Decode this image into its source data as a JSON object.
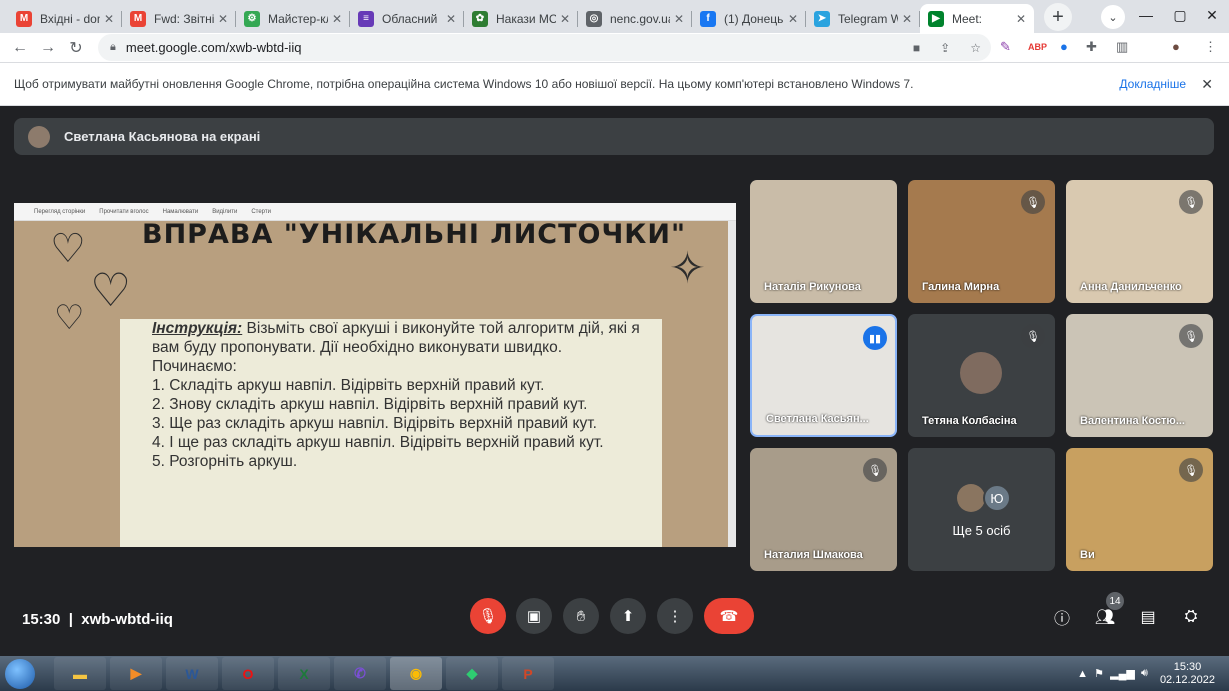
{
  "browser": {
    "tabs": [
      {
        "title": "Вхідні - dom",
        "icon": "gmail-icon",
        "color": "#ea4335",
        "glyph": "M"
      },
      {
        "title": "Fwd: Звітні",
        "icon": "gmail-icon",
        "color": "#ea4335",
        "glyph": "M"
      },
      {
        "title": "Майстер-кл",
        "icon": "site-icon",
        "color": "#34a853",
        "glyph": "⚙"
      },
      {
        "title": "Обласний",
        "icon": "forms-icon",
        "color": "#673ab7",
        "glyph": "≡"
      },
      {
        "title": "Накази МС",
        "icon": "site-icon",
        "color": "#2e7d32",
        "glyph": "✿"
      },
      {
        "title": "nenc.gov.ua",
        "icon": "globe-icon",
        "color": "#5f6368",
        "glyph": "◎"
      },
      {
        "title": "(1) Донець",
        "icon": "facebook-icon",
        "color": "#1877f2",
        "glyph": "f"
      },
      {
        "title": "Telegram W",
        "icon": "telegram-icon",
        "color": "#2aa3df",
        "glyph": "➤"
      },
      {
        "title": "Meet:",
        "icon": "meet-icon",
        "color": "#00832d",
        "glyph": "▶",
        "active": true
      }
    ],
    "url": "meet.google.com/xwb-wbtd-iiq",
    "infobar_text": "Щоб отримувати майбутні оновлення Google Chrome, потрібна операційна система Windows 10 або новішої версії. На цьому комп'ютері встановлено Windows 7.",
    "infobar_link": "Докладніше"
  },
  "meet": {
    "presenter_banner": "Светлана Касьянова на екрані",
    "slide": {
      "title": "ВПРАВА \"УНІКАЛЬНІ ЛИСТОЧКИ\"",
      "instruction_label": "Інструкція:",
      "instruction_intro": "Візьміть свої аркуші і виконуйте той алгоритм дій, які я вам буду пропонувати. Дії необхідно виконувати швидко. Починаємо:",
      "steps": [
        "1. Складіть аркуш навпіл. Відірвіть верхній правий кут.",
        "2. Знову складіть аркуш навпіл. Відірвіть верхній правий кут.",
        "3. Ще раз складіть аркуш навпіл. Відірвіть верхній правий кут.",
        "4. І ще раз складіть аркуш навпіл. Відірвіть верхній правий кут.",
        "5. Розгорніть аркуш."
      ],
      "viewer_tools": [
        "Перегляд сторінки",
        "Прочитати вголос",
        "Намалювати",
        "Виділити",
        "Стерти"
      ]
    },
    "participants": [
      {
        "name": "Наталія Рикунова",
        "muted": false,
        "bg": "#c9bca8"
      },
      {
        "name": "Галина Мирна",
        "muted": true,
        "bg": "#a57a4e"
      },
      {
        "name": "Анна Данильченко",
        "muted": true,
        "bg": "#d9c9b0"
      },
      {
        "name": "Светлана Касьян...",
        "muted": false,
        "speaking": true,
        "bg": "#e6e4e0"
      },
      {
        "name": "Тетяна Колбасіна",
        "muted": true,
        "bg": "#3c4043",
        "avatar": true
      },
      {
        "name": "Валентина Костю...",
        "muted": true,
        "bg": "#cbc4b6"
      },
      {
        "name": "Наталия Шмакова",
        "muted": true,
        "bg": "#a89c8a"
      },
      {
        "more_label": "Ще 5 осіб",
        "initial": "Ю"
      },
      {
        "name": "Ви",
        "muted": true,
        "bg": "#c8a060"
      }
    ],
    "time": "15:30",
    "meeting_code": "xwb-wbtd-iiq",
    "participant_count": "14"
  },
  "taskbar": {
    "apps": [
      "explorer",
      "media",
      "W",
      "O",
      "X",
      "viber",
      "chrome",
      "app",
      "P"
    ],
    "time": "15:30",
    "date": "02.12.2022"
  }
}
